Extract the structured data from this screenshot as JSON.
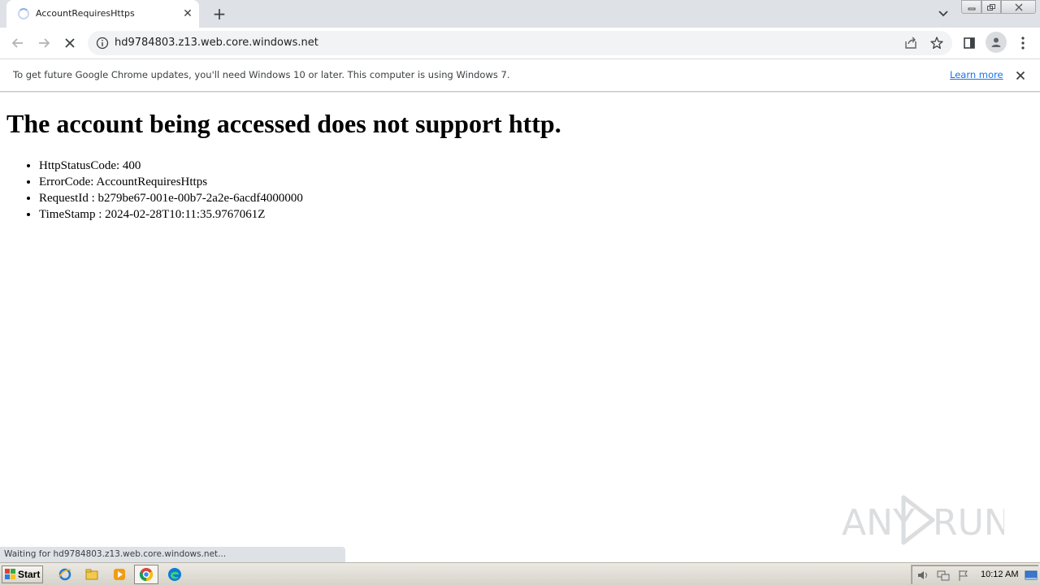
{
  "browser": {
    "tab": {
      "title": "AccountRequiresHttps",
      "close_glyph": "✕"
    },
    "newtab_glyph": "+",
    "omnibox": {
      "url": "hd9784803.z13.web.core.windows.net"
    },
    "infobar": {
      "message": "To get future Google Chrome updates, you'll need Windows 10 or later. This computer is using Windows 7.",
      "link": "Learn more"
    },
    "status": "Waiting for hd9784803.z13.web.core.windows.net..."
  },
  "page": {
    "heading": "The account being accessed does not support http.",
    "items": [
      "HttpStatusCode: 400",
      "ErrorCode: AccountRequiresHttps",
      "RequestId : b279be67-001e-00b7-2a2e-6acdf4000000",
      "TimeStamp : 2024-02-28T10:11:35.9767061Z"
    ]
  },
  "watermark": {
    "left": "ANY",
    "right": "RUN"
  },
  "taskbar": {
    "start_label": "Start",
    "clock": "10:12 AM"
  },
  "colors": {
    "link": "#1a73e8",
    "tabstrip": "#dee1e6",
    "omnibox": "#f1f3f4"
  }
}
